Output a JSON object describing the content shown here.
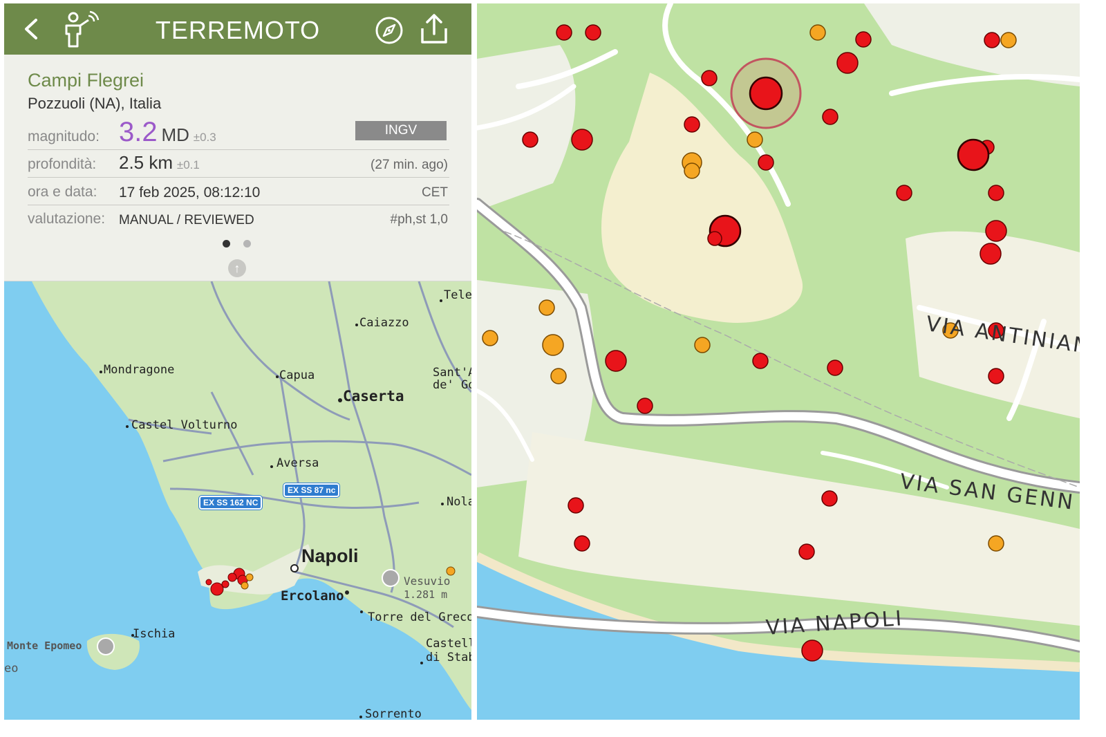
{
  "header": {
    "title": "TERREMOTO",
    "back_icon": "chevron-left-icon",
    "person_icon": "person-signal-icon",
    "compass_icon": "compass-icon",
    "share_icon": "share-icon",
    "bar_color": "#6e8a4a"
  },
  "event": {
    "place": "Campi Flegrei",
    "location": "Pozzuoli (NA), Italia",
    "magnitude_label": "magnitudo:",
    "magnitude_value": "3.2",
    "magnitude_unit": "MD",
    "magnitude_error": "±0.3",
    "source": "INGV",
    "depth_label": "profondità:",
    "depth_value": "2.5 km",
    "depth_error": "±0.1",
    "ago": "(27 min. ago)",
    "time_label": "ora e data:",
    "time_value": "17 feb 2025, 08:12:10",
    "timezone": "CET",
    "eval_label": "valutazione:",
    "eval_value": "MANUAL / REVIEWED",
    "eval_code": "#ph,st 1,0",
    "page_count": 2,
    "page_active": 1,
    "magnitude_color": "#9b59c9"
  },
  "left_map": {
    "towns": [
      "Tele",
      "Caiazzo",
      "Mondragone",
      "Capua",
      "Sant'A",
      "de' Go",
      "Caserta",
      "Castel Volturno",
      "Aversa",
      "Nola",
      "Napoli",
      "Ercolano",
      "Torre del Greco",
      "Ischia",
      "Castell",
      "di Stab",
      "Sorrento"
    ],
    "pois": {
      "vesuvio": "Vesuvio",
      "vesuvio_elev": "1.281 m",
      "epomeo": "Monte Epomeo"
    },
    "shields": [
      "EX SS 162 NC",
      "EX SS 87 nc"
    ],
    "edge": "eo"
  },
  "right_map": {
    "roads": [
      "VIA ANTINIAN",
      "VIA SAN GENN",
      "VIA NAPOLI"
    ]
  },
  "colors": {
    "quake_red": "#e8141a",
    "quake_orange": "#f5a623",
    "sea": "#7fcdf0",
    "land": "#bfe2a3"
  }
}
